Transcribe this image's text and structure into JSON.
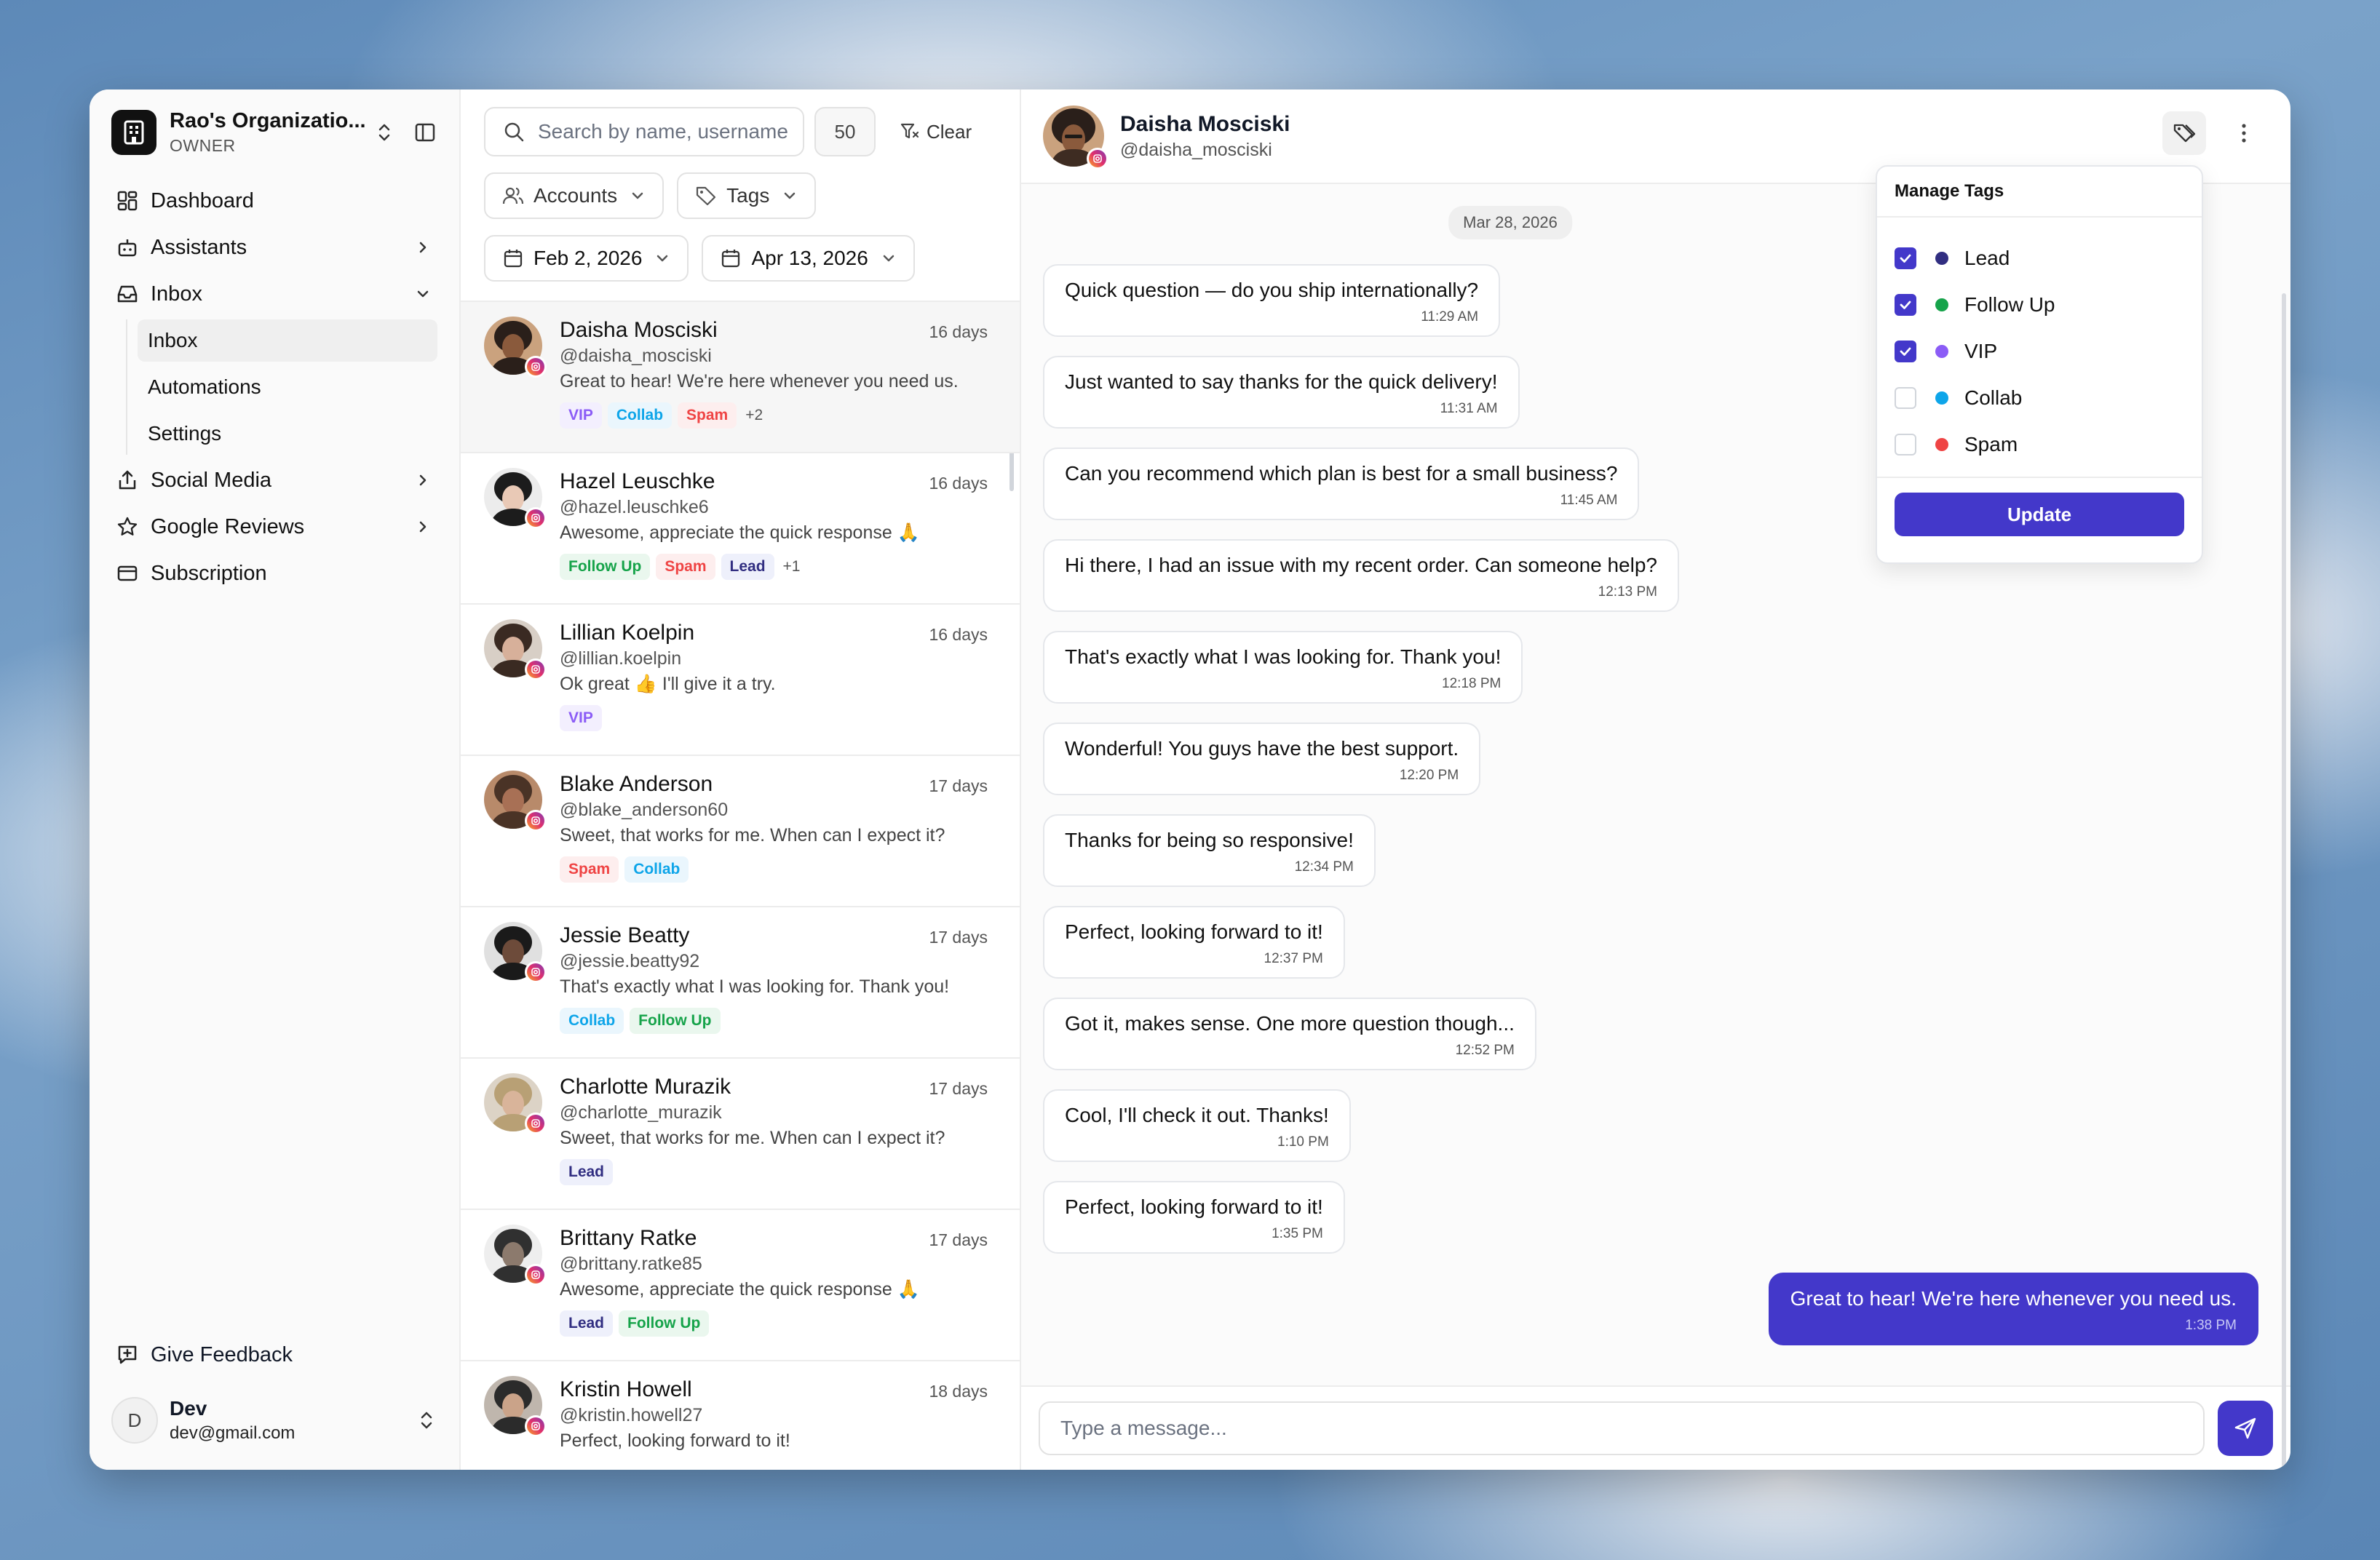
{
  "sidebar": {
    "org_name": "Rao's Organizatio...",
    "org_role": "OWNER",
    "nav": [
      {
        "label": "Dashboard"
      },
      {
        "label": "Assistants"
      },
      {
        "label": "Inbox"
      },
      {
        "label": "Social Media"
      },
      {
        "label": "Google Reviews"
      },
      {
        "label": "Subscription"
      }
    ],
    "inbox_sub": [
      {
        "label": "Inbox"
      },
      {
        "label": "Automations"
      },
      {
        "label": "Settings"
      }
    ],
    "feedback_label": "Give Feedback",
    "user": {
      "initial": "D",
      "name": "Dev",
      "email": "dev@gmail.com"
    }
  },
  "filters": {
    "search_placeholder": "Search by name, username",
    "count": "50",
    "clear_label": "Clear",
    "accounts_label": "Accounts",
    "tags_label": "Tags",
    "date_from": "Feb 2, 2026",
    "date_to": "Apr 13, 2026"
  },
  "conversations": [
    {
      "name": "Daisha Mosciski",
      "handle": "@daisha_mosciski",
      "time": "16 days",
      "preview": "Great to hear! We're here whenever you need us.",
      "tags": [
        "VIP",
        "Collab",
        "Spam"
      ],
      "more": "+2"
    },
    {
      "name": "Hazel Leuschke",
      "handle": "@hazel.leuschke6",
      "time": "16 days",
      "preview": "Awesome, appreciate the quick response 🙏",
      "tags": [
        "Follow Up",
        "Spam",
        "Lead"
      ],
      "more": "+1"
    },
    {
      "name": "Lillian Koelpin",
      "handle": "@lillian.koelpin",
      "time": "16 days",
      "preview": "Ok great 👍 I'll give it a try.",
      "tags": [
        "VIP"
      ],
      "more": ""
    },
    {
      "name": "Blake Anderson",
      "handle": "@blake_anderson60",
      "time": "17 days",
      "preview": "Sweet, that works for me. When can I expect it?",
      "tags": [
        "Spam",
        "Collab"
      ],
      "more": ""
    },
    {
      "name": "Jessie Beatty",
      "handle": "@jessie.beatty92",
      "time": "17 days",
      "preview": "That's exactly what I was looking for. Thank you!",
      "tags": [
        "Collab",
        "Follow Up"
      ],
      "more": ""
    },
    {
      "name": "Charlotte Murazik",
      "handle": "@charlotte_murazik",
      "time": "17 days",
      "preview": "Sweet, that works for me. When can I expect it?",
      "tags": [
        "Lead"
      ],
      "more": ""
    },
    {
      "name": "Brittany Ratke",
      "handle": "@brittany.ratke85",
      "time": "17 days",
      "preview": "Awesome, appreciate the quick response 🙏",
      "tags": [
        "Lead",
        "Follow Up"
      ],
      "more": ""
    },
    {
      "name": "Kristin Howell",
      "handle": "@kristin.howell27",
      "time": "18 days",
      "preview": "Perfect, looking forward to it!",
      "tags": [],
      "more": ""
    }
  ],
  "chat": {
    "name": "Daisha Mosciski",
    "handle": "@daisha_mosciski",
    "date_chip": "Mar 28, 2026",
    "messages": [
      {
        "text": "Quick question — do you ship internationally?",
        "time": "11:29 AM"
      },
      {
        "text": "Just wanted to say thanks for the quick delivery!",
        "time": "11:31 AM"
      },
      {
        "text": "Can you recommend which plan is best for a small business?",
        "time": "11:45 AM"
      },
      {
        "text": "Hi there, I had an issue with my recent order. Can someone help?",
        "time": "12:13 PM"
      },
      {
        "text": "That's exactly what I was looking for. Thank you!",
        "time": "12:18 PM"
      },
      {
        "text": "Wonderful! You guys have the best support.",
        "time": "12:20 PM"
      },
      {
        "text": "Thanks for being so responsive!",
        "time": "12:34 PM"
      },
      {
        "text": "Perfect, looking forward to it!",
        "time": "12:37 PM"
      },
      {
        "text": "Got it, makes sense. One more question though...",
        "time": "12:52 PM"
      },
      {
        "text": "Cool, I'll check it out. Thanks!",
        "time": "1:10 PM"
      },
      {
        "text": "Perfect, looking forward to it!",
        "time": "1:35 PM"
      }
    ],
    "outgoing": {
      "text": "Great to hear! We're here whenever you need us.",
      "time": "1:38 PM"
    },
    "composer_placeholder": "Type a message..."
  },
  "tag_popover": {
    "title": "Manage Tags",
    "items": [
      {
        "label": "Lead",
        "checked": true,
        "color": "#312e81"
      },
      {
        "label": "Follow Up",
        "checked": true,
        "color": "#16a34a"
      },
      {
        "label": "VIP",
        "checked": true,
        "color": "#8b5cf6"
      },
      {
        "label": "Collab",
        "checked": false,
        "color": "#0ea5e9"
      },
      {
        "label": "Spam",
        "checked": false,
        "color": "#ef4444"
      }
    ],
    "update_label": "Update"
  },
  "colors": {
    "accent": "#4338ca"
  },
  "icons": [
    "building-icon",
    "chevrons-up-down-icon",
    "sidebar-toggle-icon",
    "dashboard-icon",
    "bot-icon",
    "inbox-icon",
    "share-icon",
    "star-icon",
    "card-icon",
    "feedback-icon",
    "search-icon",
    "filter-x-icon",
    "users-icon",
    "tag-icon",
    "calendar-icon",
    "chevron-down-icon",
    "chevron-right-icon",
    "more-vertical-icon",
    "send-icon",
    "instagram-icon",
    "check-icon"
  ]
}
